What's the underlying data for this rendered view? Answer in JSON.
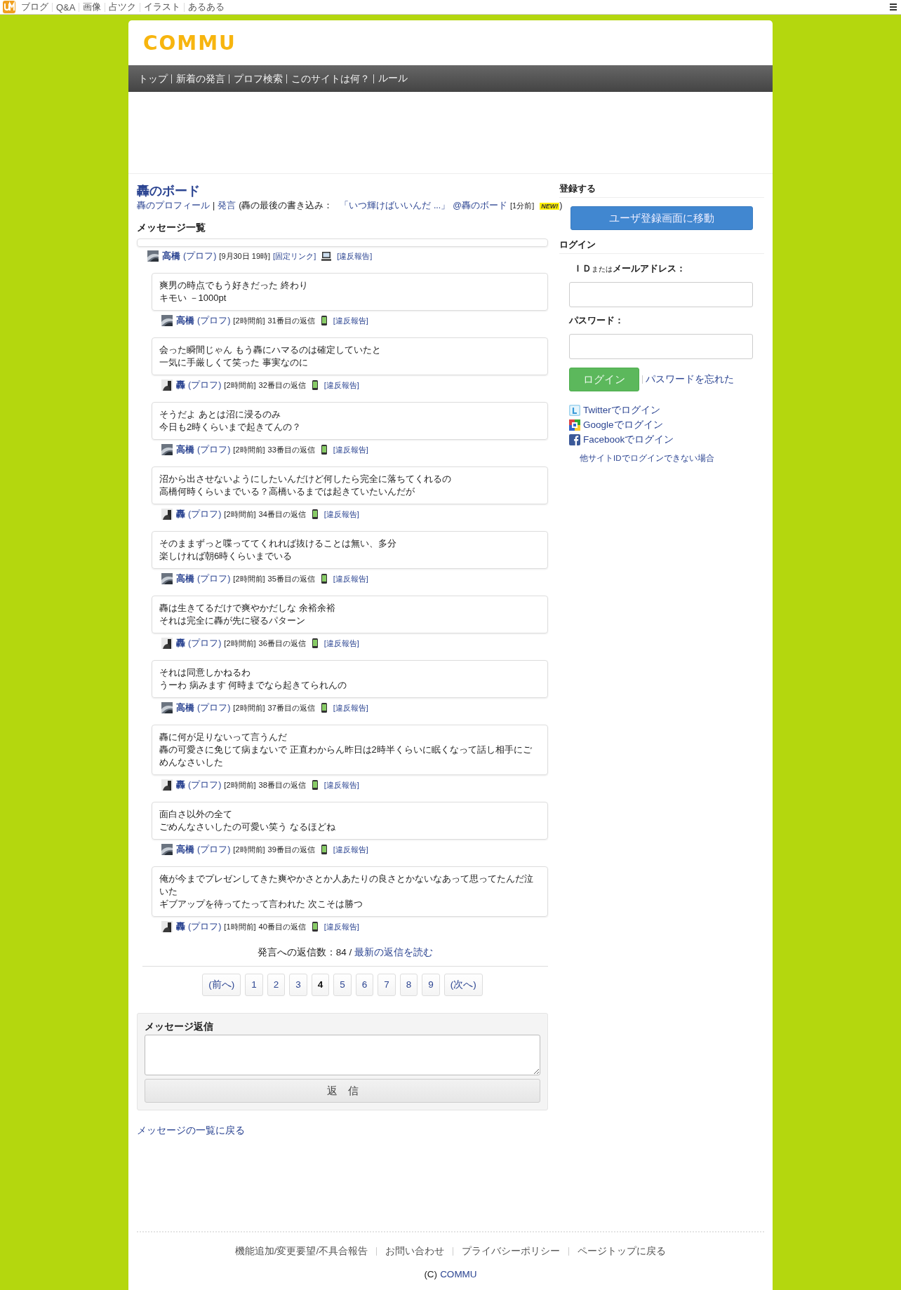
{
  "top_bar": {
    "items": [
      "ブログ",
      "Q&A",
      "画像",
      "占ツク",
      "イラスト",
      "あるある"
    ]
  },
  "logo": "COMMU",
  "nav": [
    "トップ",
    "新着の発言",
    "プロフ検索",
    "このサイトは何？",
    "ルール"
  ],
  "board": {
    "title": "轟のボード",
    "profile_link": "轟のプロフィール",
    "separator": "|",
    "post_link": "発言",
    "last_prefix": "(轟の最後の書き込み：",
    "last_quote": "「いつ輝けばいいんだ ...」",
    "last_board": "@轟のボード",
    "last_time": "[1分前]",
    "new_badge": "NEW!",
    "last_suffix": ")"
  },
  "list_heading": "メッセージ一覧",
  "top_post": {
    "author": "高橋",
    "prof": "(プロフ)",
    "time": "[9月30日 19時]",
    "permalink": "[固定リンク]",
    "report": "[違反報告]"
  },
  "replies": [
    {
      "lines": [
        "爽男の時点でもう好きだった 終わり",
        "キモい －1000pt"
      ],
      "author": "高橋",
      "prof": "(プロフ)",
      "time": "[2時間前]",
      "number": "31番目の返信",
      "report": "[違反報告]"
    },
    {
      "lines": [
        "会った瞬間じゃん もう轟にハマるのは確定していたと",
        "一気に手厳しくて笑った 事実なのに"
      ],
      "author": "轟",
      "prof": "(プロフ)",
      "time": "[2時間前]",
      "number": "32番目の返信",
      "report": "[違反報告]"
    },
    {
      "lines": [
        "そうだよ あとは沼に浸るのみ",
        "今日も2時くらいまで起きてんの？"
      ],
      "author": "高橋",
      "prof": "(プロフ)",
      "time": "[2時間前]",
      "number": "33番目の返信",
      "report": "[違反報告]"
    },
    {
      "lines": [
        "沼から出させないようにしたいんだけど何したら完全に落ちてくれるの",
        "高橋何時くらいまでいる？高橋いるまでは起きていたいんだが"
      ],
      "author": "轟",
      "prof": "(プロフ)",
      "time": "[2時間前]",
      "number": "34番目の返信",
      "report": "[違反報告]"
    },
    {
      "lines": [
        "そのままずっと喋っててくれれば抜けることは無い、多分",
        "楽しければ朝6時くらいまでいる"
      ],
      "author": "高橋",
      "prof": "(プロフ)",
      "time": "[2時間前]",
      "number": "35番目の返信",
      "report": "[違反報告]"
    },
    {
      "lines": [
        "轟は生きてるだけで爽やかだしな 余裕余裕",
        "それは完全に轟が先に寝るパターン"
      ],
      "author": "轟",
      "prof": "(プロフ)",
      "time": "[2時間前]",
      "number": "36番目の返信",
      "report": "[違反報告]"
    },
    {
      "lines": [
        "それは同意しかねるわ",
        "うーわ 病みます 何時までなら起きてられんの"
      ],
      "author": "高橋",
      "prof": "(プロフ)",
      "time": "[2時間前]",
      "number": "37番目の返信",
      "report": "[違反報告]"
    },
    {
      "lines": [
        "轟に何が足りないって言うんだ",
        "轟の可愛さに免じて病まないで 正直わからん昨日は2時半くらいに眠くなって話し相手にごめんなさいした"
      ],
      "author": "轟",
      "prof": "(プロフ)",
      "time": "[2時間前]",
      "number": "38番目の返信",
      "report": "[違反報告]"
    },
    {
      "lines": [
        "面白さ以外の全て",
        "ごめんなさいしたの可愛い笑う なるほどね"
      ],
      "author": "高橋",
      "prof": "(プロフ)",
      "time": "[2時間前]",
      "number": "39番目の返信",
      "report": "[違反報告]"
    },
    {
      "lines": [
        "俺が今までプレゼンしてきた爽やかさとか人あたりの良さとかないなあって思ってたんだ泣いた",
        "ギブアップを待ってたって言われた 次こそは勝つ"
      ],
      "author": "轟",
      "prof": "(プロフ)",
      "time": "[1時間前]",
      "number": "40番目の返信",
      "report": "[違反報告]"
    }
  ],
  "reply_count": {
    "label": "発言への返信数：84 /",
    "link": "最新の返信を読む"
  },
  "pagination": [
    {
      "label": "(前へ)",
      "selected": false
    },
    {
      "label": "1",
      "selected": false
    },
    {
      "label": "2",
      "selected": false
    },
    {
      "label": "3",
      "selected": false
    },
    {
      "label": "4",
      "selected": true
    },
    {
      "label": "5",
      "selected": false
    },
    {
      "label": "6",
      "selected": false
    },
    {
      "label": "7",
      "selected": false
    },
    {
      "label": "8",
      "selected": false
    },
    {
      "label": "9",
      "selected": false
    },
    {
      "label": "(次へ)",
      "selected": false
    }
  ],
  "reply_form": {
    "heading": "メッセージ返信",
    "button": "返　信"
  },
  "back_link": "メッセージの一覧に戻る",
  "sidebar": {
    "register_heading": "登録する",
    "register_button": "ユーザ登録画面に移動",
    "login_heading": "ログイン",
    "id_label_a": "ＩＤ",
    "id_label_b": "または",
    "id_label_c": "メールアドレス：",
    "password_label": "パスワード：",
    "login_button": "ログイン",
    "forgot": "パスワードを忘れた",
    "social": [
      {
        "kind": "twitter",
        "label": "Twitterでログイン"
      },
      {
        "kind": "google",
        "label": "Googleでログイン"
      },
      {
        "kind": "facebook",
        "label": "Facebookでログイン"
      }
    ],
    "help": "他サイトIDでログインできない場合"
  },
  "footer": {
    "links": [
      "機能追加/変更要望/不具合報告",
      "お問い合わせ",
      "プライバシーポリシー",
      "ページトップに戻る"
    ],
    "copyright": "(C)",
    "site": "COMMU"
  }
}
